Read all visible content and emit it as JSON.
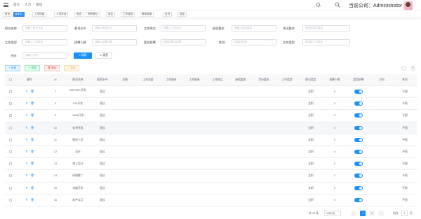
{
  "topbar": {
    "breadcrumb": [
      "首页",
      "人力",
      "职位"
    ],
    "user_label": "当前公司：Administrator"
  },
  "tags": [
    {
      "label": "首页",
      "active": false
    },
    {
      "label": "职位",
      "active": true
    },
    {
      "label": "人员档案",
      "active": false
    },
    {
      "label": "人员异动",
      "active": false
    },
    {
      "label": "首页",
      "active": false
    },
    {
      "label": "求职登记",
      "active": false
    },
    {
      "label": "单位",
      "active": false
    },
    {
      "label": "工作经验",
      "active": false
    },
    {
      "label": "教育背景",
      "active": false
    },
    {
      "label": "证书",
      "active": false
    },
    {
      "label": "奖惩",
      "active": false
    }
  ],
  "filters": {
    "row1": [
      {
        "label": "职位名称",
        "placeholder": "请输入职位名称"
      },
      {
        "label": "薪资水平",
        "placeholder": "请输入薪资水平"
      },
      {
        "label": "工作地点",
        "placeholder": "请输入工作地点"
      },
      {
        "label": "经验要求",
        "placeholder": "请输入经验要求"
      },
      {
        "label": "学历要求",
        "placeholder": "请选择学历要求"
      }
    ],
    "row2": [
      {
        "label": "工作类型",
        "placeholder": "请输入工作类型"
      },
      {
        "label": "招聘人数",
        "placeholder": "请输入招聘人数"
      },
      {
        "label": "是否招聘",
        "placeholder": "请选择是否招聘"
      },
      {
        "label": "性别",
        "placeholder": "请选择性别"
      },
      {
        "label": "工作类型",
        "placeholder": "请选择工作类型"
      }
    ],
    "row3": [
      {
        "label": "方向",
        "placeholder": "请输入方向"
      }
    ],
    "search_label": "搜索",
    "reset_label": "重置"
  },
  "actions": {
    "add": "新增",
    "edit": "修改",
    "delete": "删除",
    "export": "导出"
  },
  "table": {
    "columns": [
      "操作",
      "id",
      "职位名称",
      "薪资水平",
      "详细",
      "工作内容",
      "工作城市",
      "工作职责",
      "工作地点",
      "经验要求",
      "学历要求",
      "工作类型",
      "职位类型",
      "招聘人数",
      "是否招聘",
      "方向",
      "性别"
    ],
    "rows": [
      {
        "id": "7",
        "name": "ASP.NET开发",
        "salary": "面议",
        "job_type": "全职",
        "count": "0",
        "gender": "不限"
      },
      {
        "id": "9",
        "name": "IOS开发",
        "salary": "面议",
        "job_type": "全职",
        "count": "0",
        "gender": "不限"
      },
      {
        "id": "9",
        "name": "JAVA开发",
        "salary": "面议",
        "job_type": "全职",
        "count": "0",
        "gender": "不限"
      },
      {
        "id": "10",
        "name": "安卓开发",
        "salary": "面议",
        "job_type": "全职",
        "count": "0",
        "gender": "不限"
      },
      {
        "id": "11",
        "name": "图形人员",
        "salary": "面议",
        "job_type": "全职",
        "count": "0",
        "gender": "不限"
      },
      {
        "id": "12",
        "name": "设计",
        "salary": "面议",
        "job_type": "全职",
        "count": "0",
        "gender": "不限"
      },
      {
        "id": "13",
        "name": "美工设计",
        "salary": "面议",
        "job_type": "全职",
        "count": "0",
        "gender": "不限"
      },
      {
        "id": "14",
        "name": "网络推广",
        "salary": "面议",
        "job_type": "全职",
        "count": "0",
        "gender": "不限"
      },
      {
        "id": "15",
        "name": "电脑开发",
        "salary": "面议",
        "job_type": "全职",
        "count": "0",
        "gender": "不限"
      },
      {
        "id": "16",
        "name": "软件实习",
        "salary": "面议",
        "job_type": "全职",
        "count": "0",
        "gender": "不限"
      }
    ]
  },
  "pagination": {
    "total": "共 12 条",
    "page_size": "10条/页",
    "pages": [
      "1",
      "2"
    ],
    "goto_label": "前往",
    "goto_value": "1",
    "page_suffix": "页"
  },
  "colors": {
    "primary": "#1890ff",
    "header_bg": "#f8f8f9"
  }
}
